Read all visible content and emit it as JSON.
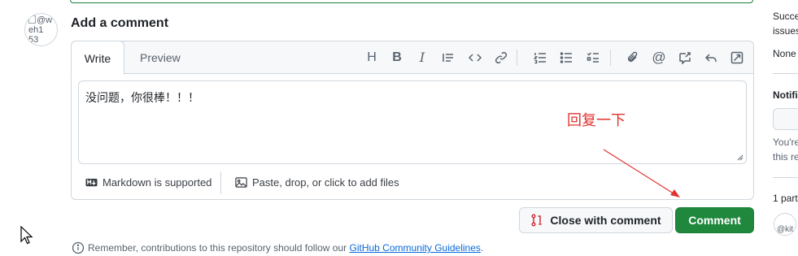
{
  "avatar": {
    "alt_line1": "@w",
    "alt_line2": "eh1",
    "alt_line3": "53"
  },
  "heading": "Add a comment",
  "tabs": {
    "write": "Write",
    "preview": "Preview"
  },
  "toolbar": {
    "icons": [
      "heading-icon",
      "bold-icon",
      "italic-icon",
      "quote-icon",
      "code-icon",
      "link-icon",
      "numbered-list-icon",
      "unordered-list-icon",
      "task-list-icon",
      "attach-icon",
      "mention-icon",
      "reference-icon",
      "reply-icon",
      "fullscreen-icon"
    ],
    "bold_glyph": "B",
    "italic_glyph": "I",
    "heading_glyph": "H",
    "mention_glyph": "@"
  },
  "editor": {
    "value": "没问题，你很棒！！！"
  },
  "footer": {
    "markdown_label": "Markdown is supported",
    "attach_label": "Paste, drop, or click to add files"
  },
  "annotation": {
    "text": "回复一下",
    "color": "#e0332f"
  },
  "buttons": {
    "close_label": "Close with comment",
    "comment_label": "Comment"
  },
  "notice": {
    "prefix": "Remember, contributions to this repository should follow our ",
    "link": "GitHub Community Guidelines",
    "suffix": "."
  },
  "sidebar": {
    "text1": "Succe",
    "text2": "issues",
    "text3": "None",
    "notif": "Notifi",
    "text4": "You're",
    "text5": "this re",
    "participants": "1 part",
    "avatar_alt": "@kit"
  },
  "colors": {
    "accent_green": "#1f883d",
    "link_blue": "#0969da",
    "border": "#d0d7de"
  }
}
